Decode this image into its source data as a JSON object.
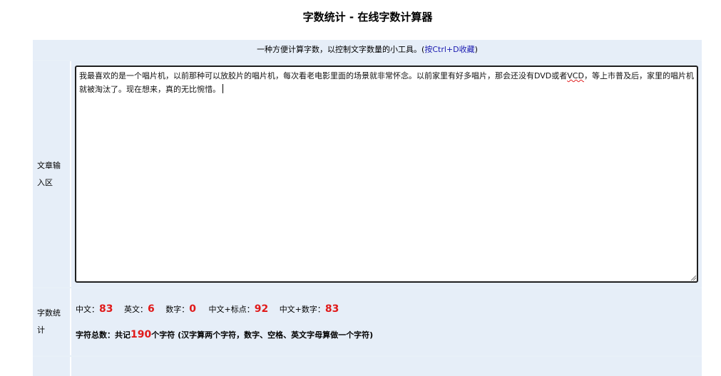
{
  "page": {
    "title": "字数统计 - 在线字数计算器"
  },
  "intro": {
    "text": "一种方便计算字数，以控制文字数量的小工具。(",
    "bookmark_link": "按Ctrl+D收藏",
    "close_paren": ")"
  },
  "input_section": {
    "label": "文章输入区",
    "text_part1": "我最喜欢的是一个唱片机，以前那种可以放胶片的唱片机，每次看老电影里面的场景就非常怀念。以前家里有好多唱片，那会还没有DVD或者",
    "text_misspelled": "VCD",
    "text_part2": "，等上市普及后，家里的唱片机就被淘汰了。现在想来，真的无比惋惜。"
  },
  "stats_section": {
    "label": "字数统计",
    "chinese_label": "中文：",
    "chinese_value": "83",
    "english_label": "英文：",
    "english_value": "6",
    "digits_label": "数字：",
    "digits_value": "0",
    "chinese_punct_label": "中文+标点：",
    "chinese_punct_value": "92",
    "chinese_digits_label": "中文+数字：",
    "chinese_digits_value": "83",
    "total_prefix": "字符总数：共记",
    "total_value": "190",
    "total_suffix": "个字符 (汉字算两个字符，数字、空格、英文字母算做一个字符)"
  },
  "colors": {
    "accent_red": "#e01a1a",
    "link_blue": "#1a1ab0",
    "panel_bg": "#e6eef8"
  }
}
